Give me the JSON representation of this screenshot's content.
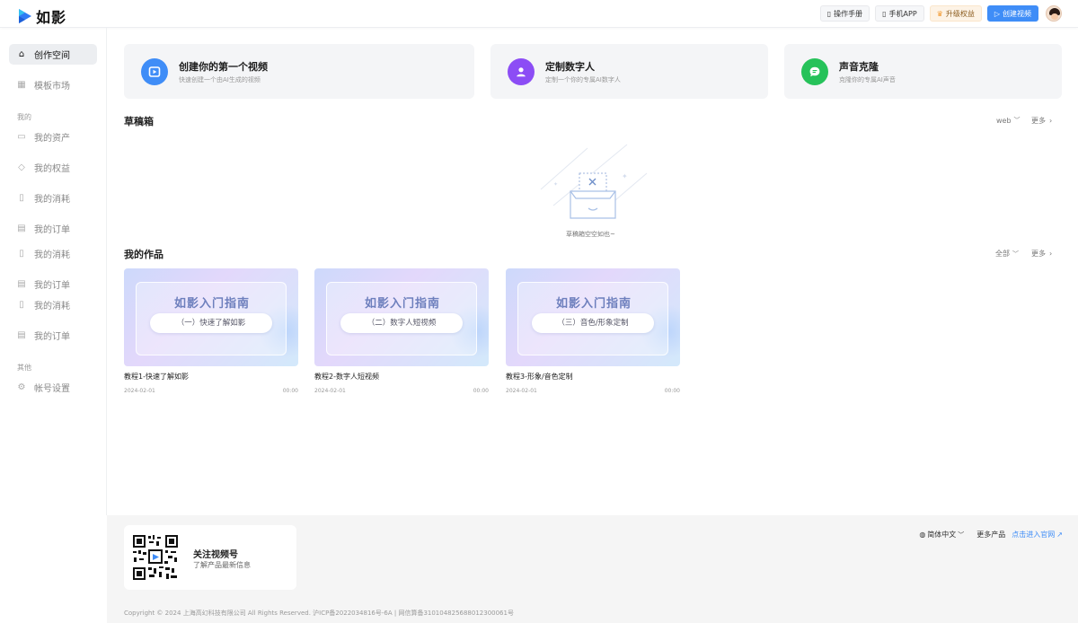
{
  "app": {
    "name": "如影"
  },
  "topbar": {
    "manual": "操作手册",
    "mobile_app": "手机APP",
    "upgrade": "升级权益",
    "create_video": "创建视频"
  },
  "sidebar": {
    "items": [
      {
        "label": "创作空间",
        "icon": "home-icon",
        "active": true
      },
      {
        "label": "模板市场",
        "icon": "template-icon"
      }
    ],
    "group_mine": "我的",
    "mine_items": [
      {
        "label": "我的资产",
        "icon": "wallet-icon"
      },
      {
        "label": "我的权益",
        "icon": "diamond-icon"
      },
      {
        "label": "我的消耗",
        "icon": "book-icon"
      },
      {
        "label": "我的订单",
        "icon": "clipboard-icon"
      },
      {
        "label": "我的消耗",
        "icon": "book-icon"
      },
      {
        "label": "我的订单",
        "icon": "calendar-icon"
      },
      {
        "label": "我的消耗",
        "icon": "book-icon"
      },
      {
        "label": "我的订单",
        "icon": "clipboard-icon"
      }
    ],
    "group_other": "其他",
    "other_items": [
      {
        "label": "帐号设置",
        "icon": "gear-icon"
      }
    ]
  },
  "cards": [
    {
      "title": "创建你的第一个视频",
      "subtitle": "快速创建一个由AI生成的视频",
      "icon": "video-play-icon",
      "color": "#3f8df7"
    },
    {
      "title": "定制数字人",
      "subtitle": "定制一个你的专属AI数字人",
      "icon": "person-icon",
      "color": "#8c4df5"
    },
    {
      "title": "声音克隆",
      "subtitle": "克隆你的专属AI声音",
      "icon": "voice-icon",
      "color": "#26c25a"
    }
  ],
  "drafts": {
    "title": "草稿箱",
    "filter": "web",
    "more": "更多",
    "empty": "草稿箱空空如也~"
  },
  "works": {
    "title": "我的作品",
    "filter": "全部",
    "more": "更多",
    "items": [
      {
        "banner_title": "如影入门指南",
        "banner_pill": "（一）快速了解如影",
        "name": "教程1-快速了解如影",
        "date": "2024-02-01",
        "duration": "00:00"
      },
      {
        "banner_title": "如影入门指南",
        "banner_pill": "（二）数字人短视频",
        "name": "教程2-数字人短视频",
        "date": "2024-02-01",
        "duration": "00:00"
      },
      {
        "banner_title": "如影入门指南",
        "banner_pill": "（三）音色/形象定制",
        "name": "教程3-形象/音色定制",
        "date": "2024-02-01",
        "duration": "00:00"
      }
    ]
  },
  "footer": {
    "qr_title": "关注视频号",
    "qr_subtitle": "了解产品最新信息",
    "language": "简体中文",
    "more_products": "更多产品",
    "official_site": "点击进入官网",
    "copyright": "Copyright © 2024 上海高幻科技有限公司 All Rights Reserved. 沪ICP备2022034816号-6A | 网信算备310104825688012300061号"
  }
}
